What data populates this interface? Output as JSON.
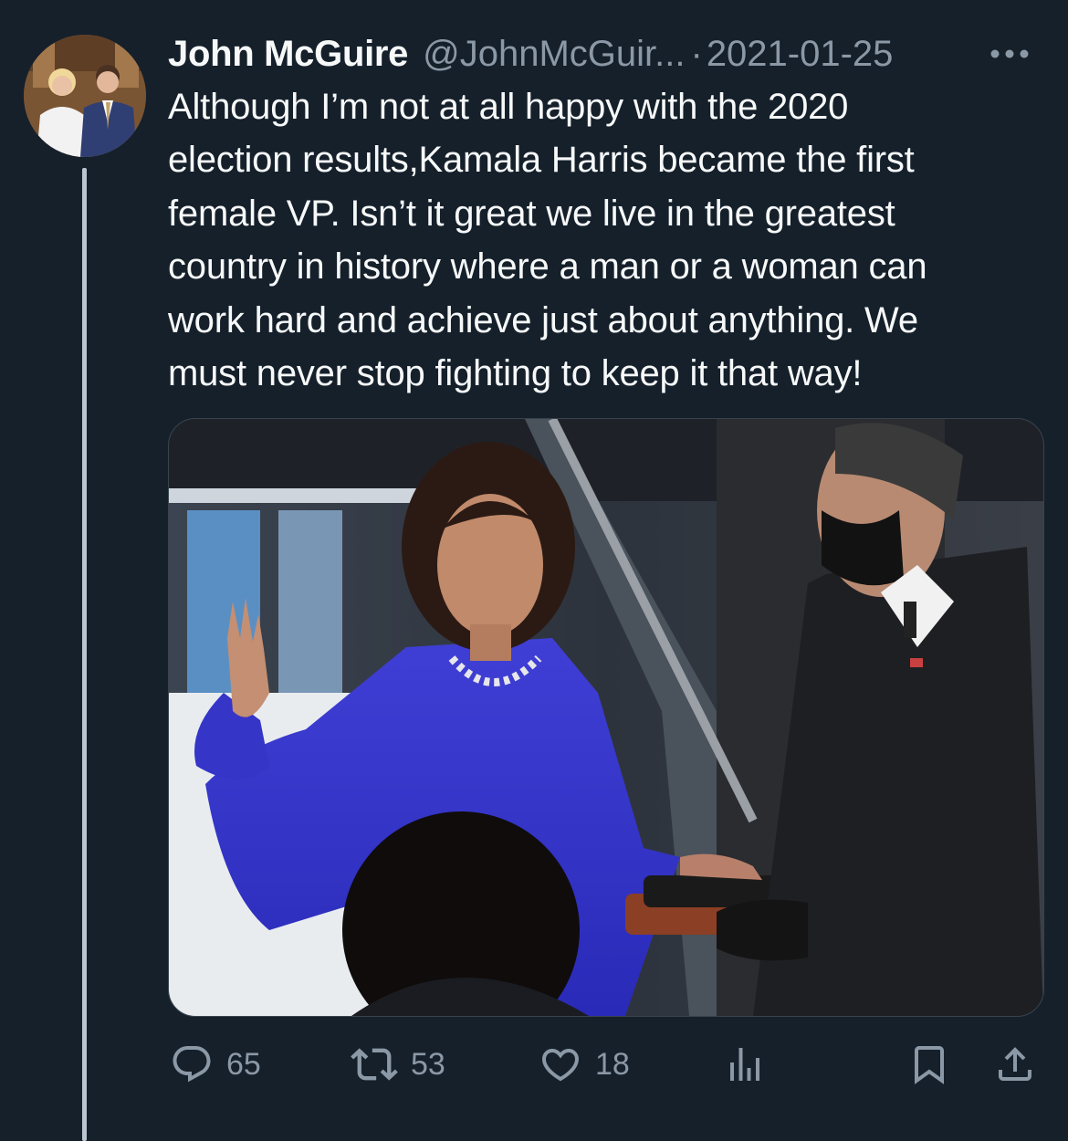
{
  "tweet": {
    "author_name": "John McGuire",
    "handle": "@JohnMcGuir...",
    "separator": "·",
    "date": "2021-01-25",
    "more_icon": "more-horizontal-icon",
    "text_lines": [
      "Although I’m not at all happy with the 2020",
      "election results,Kamala Harris became the first",
      "female VP.  Isn’t it great we live in the greatest",
      "country in history where a man or a woman can",
      "work hard and achieve just about anything. We",
      "must never stop fighting to keep it that way!"
    ]
  },
  "actions": {
    "reply": {
      "icon": "reply-icon",
      "count": "65"
    },
    "retweet": {
      "icon": "retweet-icon",
      "count": "53"
    },
    "like": {
      "icon": "heart-icon",
      "count": "18"
    },
    "views": {
      "icon": "analytics-icon"
    },
    "bookmark": {
      "icon": "bookmark-icon"
    },
    "share": {
      "icon": "share-icon"
    }
  },
  "colors": {
    "background": "#15202b",
    "primary_text": "#f7f9f9",
    "secondary_text": "#8b98a5",
    "thread_line": "#b9c6d1"
  }
}
